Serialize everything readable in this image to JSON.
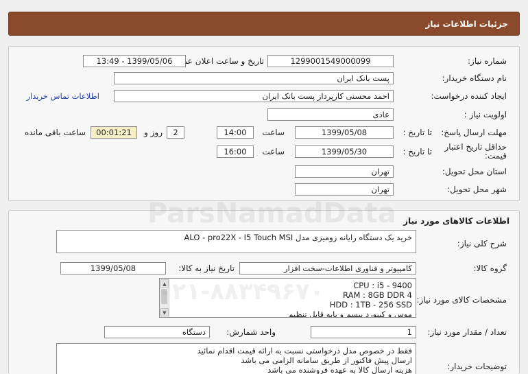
{
  "header": {
    "title": "جزئیات اطلاعات نیاز"
  },
  "info": {
    "need_number_label": "شماره نیاز:",
    "need_number": "1299001549000099",
    "announce_label": "تاریخ و ساعت اعلان عمومی:",
    "announce_value": "1399/05/06 - 13:49",
    "buyer_org_label": "نام دستگاه خریدار:",
    "buyer_org": "پست بانک ایران",
    "requester_label": "ایجاد کننده درخواست:",
    "requester": "احمد  محسنی کارپرداز پست بانک ایران",
    "contact_link": "اطلاعات تماس خریدار",
    "priority_label": "اولویت نیاز :",
    "priority": "عادی",
    "deadline_label": "مهلت ارسال پاسخ:",
    "to_date_label": "تا تاریخ :",
    "deadline_date": "1399/05/08",
    "time_label": "ساعت",
    "deadline_time": "14:00",
    "days_value": "2",
    "days_label": "روز و",
    "remaining_time": "00:01:21",
    "remaining_label": "ساعت باقی مانده",
    "validity_label": "حداقل تاریخ اعتبار قیمت:",
    "validity_to_label": "تا تاریخ :",
    "validity_date": "1399/05/30",
    "validity_time_label": "ساعت",
    "validity_time": "16:00",
    "province_label": "استان محل تحویل:",
    "province": "تهران",
    "city_label": "شهر محل تحویل:",
    "city": "تهران"
  },
  "goods": {
    "section_title": "اطلاعات کالاهای مورد نیاز",
    "summary_label": "شرح کلی نیاز:",
    "summary": "خرید یک دستگاه رایانه رومیزی مدل ALO - pro22X - I5  Touch MSI",
    "group_label": "گروه کالا:",
    "group": "کامپیوتر و فناوری اطلاعات-سخت افزار",
    "need_date_label": "تاریخ نیاز به کالا:",
    "need_date": "1399/05/08",
    "spec_label": "مشخصات کالای مورد نیاز:",
    "spec_lines": [
      "CPU : i5 - 9400",
      "RAM : 8GB DDR 4",
      "HDD : 1TB - 256 SSD",
      "موس و کیبورد بیسم و پایه قابل تنظیم"
    ],
    "qty_label": "تعداد / مقدار مورد نیاز:",
    "qty": "1",
    "unit_label": "واحد شمارش:",
    "unit": "دستگاه",
    "notes_label": "توضیحات خریدار:",
    "notes_lines": [
      "فقط در خصوص مدل درخواستی نسبت به ارائه قیمت اقدام نمائید",
      "ارسال پیش فاکتور از طریق سامانه الزامی می باشد",
      "هزینه ارسال کالا به عهده فروشنده می باشد"
    ]
  },
  "watermark": {
    "brand": "ParsNamadData",
    "phone": "۰۲۱-۸۸۳۴۹۶۷۰"
  },
  "colors": {
    "header_bg": "#8b4a2c",
    "link": "#1f3fa8",
    "highlight": "#f7f0c6"
  }
}
